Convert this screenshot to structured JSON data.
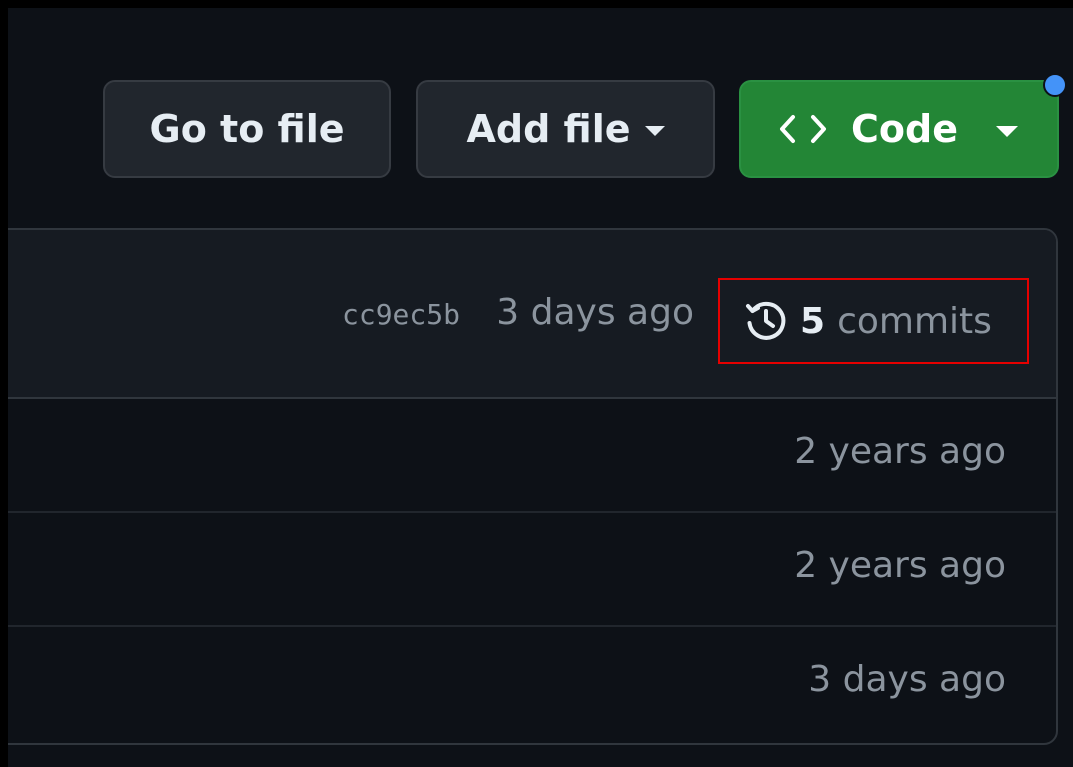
{
  "toolbar": {
    "go_to_file_label": "Go to file",
    "add_file_label": "Add file",
    "code_label": "Code"
  },
  "latest_commit": {
    "sha": "cc9ec5b",
    "time": "3 days ago",
    "commit_count": "5",
    "commits_label": "commits"
  },
  "file_rows": [
    {
      "time": "2 years ago"
    },
    {
      "time": "2 years ago"
    },
    {
      "time": "3 days ago"
    }
  ],
  "colors": {
    "page_background": "#0d1117",
    "button_background": "#21262d",
    "code_button_green": "#238636",
    "notification_dot": "#4493f8",
    "highlight_box": "#e50000",
    "muted_text": "#8b949e"
  },
  "icons": [
    "chevron-down-icon",
    "code-brackets-icon",
    "history-icon"
  ]
}
